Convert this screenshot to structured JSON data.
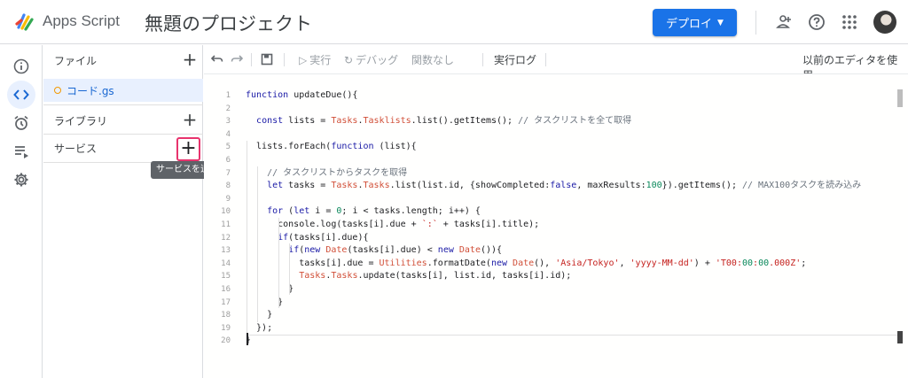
{
  "header": {
    "app_name": "Apps Script",
    "project_title": "無題のプロジェクト",
    "deploy_label": "デプロイ",
    "icons": [
      "add-person-icon",
      "help-icon",
      "apps-grid-icon",
      "avatar"
    ]
  },
  "rail": {
    "items": [
      "info-icon",
      "code-icon",
      "alarm-icon",
      "executions-icon",
      "settings-icon"
    ]
  },
  "panel": {
    "files_label": "ファイル",
    "file_name": "コード.gs",
    "libraries_label": "ライブラリ",
    "services_label": "サービス",
    "tooltip": "サービスを追加"
  },
  "toolbar": {
    "run_label": "実行",
    "debug_label": "デバッグ",
    "function_label": "関数なし",
    "log_label": "実行ログ",
    "legacy_label": "以前のエディタを使用"
  },
  "editor": {
    "line_numbers": [
      "1",
      "2",
      "3",
      "4",
      "5",
      "6",
      "7",
      "8",
      "9",
      "10",
      "11",
      "12",
      "13",
      "14",
      "15",
      "16",
      "17",
      "18",
      "19",
      "20"
    ],
    "code_lines": [
      "function updateDue(){",
      "",
      "  const lists = Tasks.Tasklists.list().getItems(); // タスクリストを全て取得",
      "",
      "  lists.forEach(function (list){",
      "",
      "    // タスクリストからタスクを取得",
      "    let tasks = Tasks.Tasks.list(list.id, {showCompleted:false, maxResults:100}).getItems(); // MAX100タスクを読み込み",
      "",
      "    for (let i = 0; i < tasks.length; i++) {",
      "      console.log(tasks[i].due + `:` + tasks[i].title);",
      "      if(tasks[i].due){",
      "        if(new Date(tasks[i].due) < new Date()){",
      "          tasks[i].due = Utilities.formatDate(new Date(), 'Asia/Tokyo', 'yyyy-MM-dd') + 'T00:00:00.000Z';",
      "          Tasks.Tasks.update(tasks[i], list.id, tasks[i].id);",
      "        }",
      "      }",
      "    }",
      "  });",
      "}"
    ]
  },
  "colors": {
    "accent": "#1a73e8",
    "highlight": "#e8336d",
    "selected_bg": "#e8f0fe"
  }
}
